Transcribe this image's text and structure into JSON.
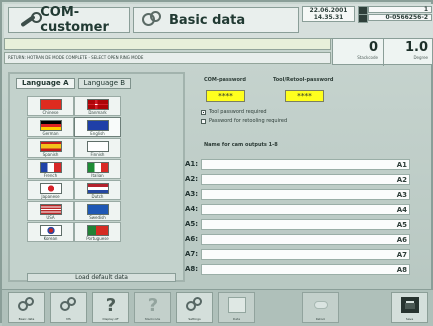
{
  "header": {
    "left_title": "COM-customer",
    "center_title": "Basic data",
    "date": "22.06.2001",
    "time": "14.35.31",
    "counter_top": "1",
    "counter_bottom": "0-0566256-2"
  },
  "status": {
    "mode_text": "RETURN: HOTRAN DE MODE COMPLETE - SELECT OPEN RING MODE"
  },
  "metrics": {
    "left_value": "0",
    "left_label": "Stackcode",
    "right_value": "1.0",
    "right_label": "Degree"
  },
  "language_panel": {
    "tab_a": "Language A",
    "tab_b": "Language B",
    "load_default_label": "Load default data",
    "flags": [
      {
        "name": "china-flag",
        "label": "Chinese"
      },
      {
        "name": "denmark-flag",
        "label": "Danmark"
      },
      {
        "name": "germany-flag",
        "label": "German"
      },
      {
        "name": "uk-flag",
        "label": "English"
      },
      {
        "name": "spain-flag",
        "label": "Spanish"
      },
      {
        "name": "finland-flag",
        "label": "Finnish"
      },
      {
        "name": "france-flag",
        "label": "French"
      },
      {
        "name": "italy-flag",
        "label": "Italian"
      },
      {
        "name": "japan-flag",
        "label": "Japanese"
      },
      {
        "name": "netherlands-flag",
        "label": "Dutch"
      },
      {
        "name": "usa-flag",
        "label": "USA"
      },
      {
        "name": "sweden-flag",
        "label": "Swedish"
      },
      {
        "name": "korea-flag",
        "label": "Korean"
      },
      {
        "name": "portugal-flag",
        "label": "Portuguese"
      }
    ]
  },
  "password_panel": {
    "com_label": "COM-password",
    "tool_label": "Tool/Retool-password",
    "com_value": "****",
    "tool_value": "****",
    "tool_required_text": "Tool password required",
    "retooling_required_text": "Password for retooling required"
  },
  "outputs": {
    "title": "Name for cam outputs 1-8",
    "rows": [
      {
        "left": "A1:",
        "right": "A1"
      },
      {
        "left": "A2:",
        "right": "A2"
      },
      {
        "left": "A3:",
        "right": "A3"
      },
      {
        "left": "A4:",
        "right": "A4"
      },
      {
        "left": "A5:",
        "right": "A5"
      },
      {
        "left": "A6:",
        "right": "A6"
      },
      {
        "left": "A7:",
        "right": "A7"
      },
      {
        "left": "A8:",
        "right": "A8"
      }
    ]
  },
  "toolbar": {
    "buttons": [
      {
        "name": "basic-data-button",
        "label": "Basic data"
      },
      {
        "name": "ms-button",
        "label": "MS"
      },
      {
        "name": "help-button",
        "label": "Display off"
      },
      {
        "name": "disabled-button",
        "label": "Stackcode"
      },
      {
        "name": "settings-button",
        "label": "Settings"
      },
      {
        "name": "doc-button",
        "label": "Data"
      },
      {
        "name": "cloud-button",
        "label": "Retool"
      },
      {
        "name": "save-button",
        "label": "Save"
      }
    ]
  },
  "colors": {
    "accent_yellow": "#ffff1e",
    "panel_bg": "#c3d2cc"
  }
}
